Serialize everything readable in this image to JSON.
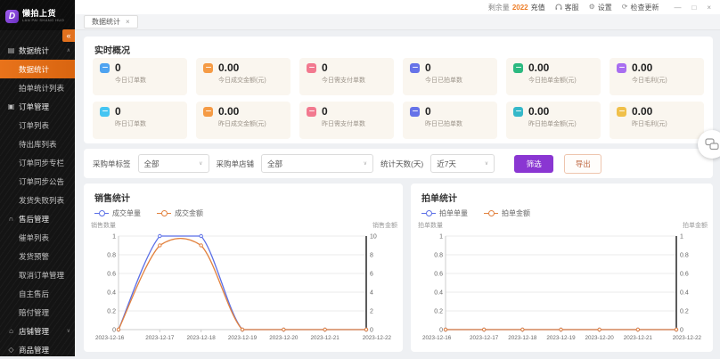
{
  "logo": {
    "mark": "D",
    "name": "懒拍上货",
    "sub": "LAN PAI SHANG HUO"
  },
  "sidebar": {
    "items": [
      {
        "type": "group",
        "label": "数据统计",
        "icon": "chart-icon",
        "caret": "∧"
      },
      {
        "type": "sub",
        "label": "数据统计",
        "active": true
      },
      {
        "type": "sub",
        "label": "拍单统计列表"
      },
      {
        "type": "group",
        "label": "订单管理",
        "icon": "order-icon"
      },
      {
        "type": "sub",
        "label": "订单列表"
      },
      {
        "type": "sub",
        "label": "待出库列表"
      },
      {
        "type": "sub",
        "label": "订单同步专栏"
      },
      {
        "type": "sub",
        "label": "订单同步公告"
      },
      {
        "type": "sub",
        "label": "发货失败列表"
      },
      {
        "type": "group",
        "label": "售后管理",
        "icon": "aftersale-icon"
      },
      {
        "type": "sub",
        "label": "催单列表"
      },
      {
        "type": "sub",
        "label": "发货预警"
      },
      {
        "type": "sub",
        "label": "取消订单管理"
      },
      {
        "type": "sub",
        "label": "自主售后"
      },
      {
        "type": "sub",
        "label": "赔付管理"
      },
      {
        "type": "group",
        "label": "店铺管理",
        "icon": "shop-icon",
        "caret": "∨"
      },
      {
        "type": "group",
        "label": "商品管理",
        "icon": "goods-icon"
      }
    ],
    "collapse_glyph": "«"
  },
  "topbar": {
    "balance_label": "剩余量",
    "balance_value": "2022",
    "recharge": "充值",
    "service": "客服",
    "settings": "设置",
    "check_update": "检查更新",
    "win_min": "—",
    "win_max": "□",
    "win_close": "×"
  },
  "tab": {
    "label": "数据统计",
    "close": "×"
  },
  "overview": {
    "title": "实时概况",
    "cards": [
      {
        "value": "0",
        "label": "今日订单数",
        "color": "#4ea3f0"
      },
      {
        "value": "0.00",
        "label": "今日成交金额(元)",
        "color": "#f59b45"
      },
      {
        "value": "0",
        "label": "今日需支付单数",
        "color": "#f2798f"
      },
      {
        "value": "0",
        "label": "今日已拍单数",
        "color": "#6673e8"
      },
      {
        "value": "0.00",
        "label": "今日拍单金额(元)",
        "color": "#2bb980"
      },
      {
        "value": "0.00",
        "label": "今日毛利(元)",
        "color": "#a86ef0"
      },
      {
        "value": "0",
        "label": "昨日订单数",
        "color": "#45c5f2"
      },
      {
        "value": "0.00",
        "label": "昨日成交金额(元)",
        "color": "#f59b45"
      },
      {
        "value": "0",
        "label": "昨日需支付单数",
        "color": "#f2798f"
      },
      {
        "value": "0",
        "label": "昨日已拍单数",
        "color": "#6673e8"
      },
      {
        "value": "0.00",
        "label": "昨日拍单金额(元)",
        "color": "#35b8c9"
      },
      {
        "value": "0.00",
        "label": "昨日毛利(元)",
        "color": "#f0c04a"
      }
    ]
  },
  "filters": {
    "f1_label": "采购单标签",
    "f1_value": "全部",
    "f2_label": "采购单店铺",
    "f2_value": "全部",
    "f3_label": "统计天数(天)",
    "f3_value": "近7天",
    "search_label": "筛选",
    "export_label": "导出"
  },
  "chart_data": [
    {
      "type": "line",
      "title": "销售统计",
      "x": [
        "2023-12-16",
        "2023-12-17",
        "2023-12-18",
        "2023-12-19",
        "2023-12-20",
        "2023-12-21",
        "2023-12-22"
      ],
      "y_left": {
        "name": "销售数量",
        "min": 0,
        "max": 1,
        "ticks": [
          0,
          0.2,
          0.4,
          0.6,
          0.8,
          1
        ]
      },
      "y_right": {
        "name": "销售金额",
        "min": 0,
        "max": 10,
        "ticks": [
          0,
          2,
          4,
          6,
          8,
          10
        ]
      },
      "series": [
        {
          "name": "成交单量",
          "axis": "left",
          "color": "#5b6fe6",
          "values": [
            0,
            1,
            1,
            0,
            0,
            0,
            0
          ]
        },
        {
          "name": "成交金额",
          "axis": "right",
          "color": "#e2823f",
          "values": [
            0,
            9,
            9,
            0,
            0,
            0,
            0
          ]
        }
      ],
      "legend_position": "top-left",
      "grid": true
    },
    {
      "type": "line",
      "title": "拍单统计",
      "x": [
        "2023-12-16",
        "2023-12-17",
        "2023-12-18",
        "2023-12-19",
        "2023-12-20",
        "2023-12-21",
        "2023-12-22"
      ],
      "y_left": {
        "name": "拍单数量",
        "min": 0,
        "max": 1,
        "ticks": [
          0,
          0.2,
          0.4,
          0.6,
          0.8,
          1
        ]
      },
      "y_right": {
        "name": "拍单金额",
        "min": 0,
        "max": 1,
        "ticks": [
          0,
          0.2,
          0.4,
          0.6,
          0.8,
          1
        ]
      },
      "series": [
        {
          "name": "拍单单量",
          "axis": "left",
          "color": "#5b6fe6",
          "values": [
            0,
            0,
            0,
            0,
            0,
            0,
            0
          ]
        },
        {
          "name": "拍单金额",
          "axis": "right",
          "color": "#e2823f",
          "values": [
            0,
            0,
            0,
            0,
            0,
            0,
            0
          ]
        }
      ],
      "legend_position": "top-left",
      "grid": true
    }
  ]
}
